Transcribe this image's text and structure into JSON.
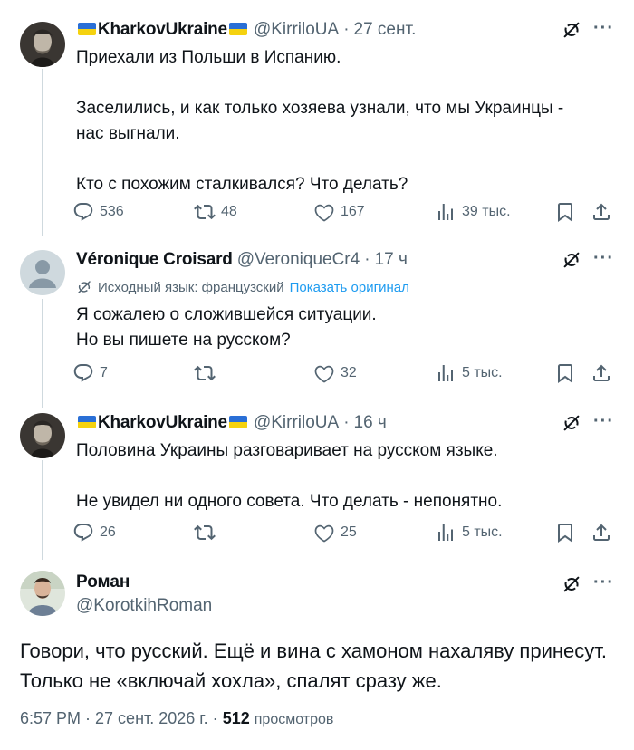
{
  "tweets": [
    {
      "name": "KharkovUkraine",
      "handle": "@KirriloUA",
      "time": "27 сент.",
      "text": "Приехали из Польши в Испанию.\n\nЗаселились, и как только хозяева узнали, что мы Украинцы -\nнас выгнали.\n\nКто с похожим сталкивался? Что делать?",
      "replies": "536",
      "reposts": "48",
      "likes": "167",
      "views": "39 тыс."
    },
    {
      "name": "Véronique Croisard",
      "handle": "@VeroniqueCr4",
      "time": "17 ч",
      "translation_note": "Исходный язык: французский",
      "translation_link": "Показать оригинал",
      "text": "Я сожалею о сложившейся ситуации.\nНо вы пишете на русском?",
      "replies": "7",
      "reposts": "",
      "likes": "32",
      "views": "5 тыс."
    },
    {
      "name": "KharkovUkraine",
      "handle": "@KirriloUA",
      "time": "16 ч",
      "text": "Половина Украины разговаривает на русском языке.\n\nНе увидел ни одного совета. Что делать - непонятно.",
      "replies": "26",
      "reposts": "",
      "likes": "25",
      "views": "5 тыс."
    }
  ],
  "main_tweet": {
    "name": "Роман",
    "handle": "@KorotkihRoman",
    "text": "Говори, что русский. Ещё и вина с хамоном нахаляву принесут.\nТолько не «включай хохла», спалят сразу же.",
    "timestamp": "6:57 PM · 27 сент. 2026 г. ·",
    "views_count": "512",
    "views_label": "просмотров"
  },
  "ui": {
    "separator": "·",
    "more": "···",
    "icons": [
      "reply-icon",
      "repost-icon",
      "like-icon",
      "views-icon",
      "bookmark-icon",
      "share-icon",
      "grok-icon",
      "more-icon",
      "ukraine-flag-icon",
      "translate-icon"
    ],
    "colors": {
      "text": "#0f1419",
      "muted": "#536471",
      "link": "#1d9bf0",
      "line": "#cfd9de",
      "flag_blue": "#2a6fd6",
      "flag_yellow": "#f5d20f"
    }
  }
}
